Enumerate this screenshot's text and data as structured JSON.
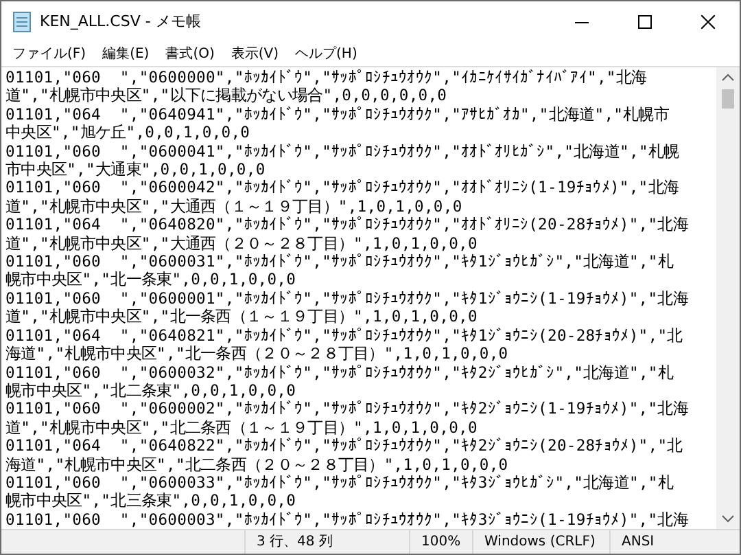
{
  "window": {
    "title": "KEN_ALL.CSV - メモ帳"
  },
  "menu": [
    "ファイル(F)",
    "編集(E)",
    "書式(O)",
    "表示(V)",
    "ヘルプ(H)"
  ],
  "lines": [
    "01101,\"060  \",\"0600000\",\"ﾎｯｶｲﾄﾞｳ\",\"ｻｯﾎﾟﾛｼﾁｭｳｵｳｸ\",\"ｲｶﾆｹｲｻｲｶﾞﾅｲﾊﾞｱｲ\",\"北海",
    "道\",\"札幌市中央区\",\"以下に掲載がない場合\",0,0,0,0,0,0",
    "01101,\"064  \",\"0640941\",\"ﾎｯｶｲﾄﾞｳ\",\"ｻｯﾎﾟﾛｼﾁｭｳｵｳｸ\",\"ｱｻﾋｶﾞｵｶ\",\"北海道\",\"札幌市",
    "中央区\",\"旭ケ丘\",0,0,1,0,0,0",
    "01101,\"060  \",\"0600041\",\"ﾎｯｶｲﾄﾞｳ\",\"ｻｯﾎﾟﾛｼﾁｭｳｵｳｸ\",\"ｵｵﾄﾞｵﾘﾋｶﾞｼ\",\"北海道\",\"札幌",
    "市中央区\",\"大通東\",0,0,1,0,0,0",
    "01101,\"060  \",\"0600042\",\"ﾎｯｶｲﾄﾞｳ\",\"ｻｯﾎﾟﾛｼﾁｭｳｵｳｸ\",\"ｵｵﾄﾞｵﾘﾆｼ(1-19ﾁｮｳﾒ)\",\"北海",
    "道\",\"札幌市中央区\",\"大通西（１～１９丁目）\",1,0,1,0,0,0",
    "01101,\"064  \",\"0640820\",\"ﾎｯｶｲﾄﾞｳ\",\"ｻｯﾎﾟﾛｼﾁｭｳｵｳｸ\",\"ｵｵﾄﾞｵﾘﾆｼ(20-28ﾁｮｳﾒ)\",\"北海",
    "道\",\"札幌市中央区\",\"大通西（２０～２８丁目）\",1,0,1,0,0,0",
    "01101,\"060  \",\"0600031\",\"ﾎｯｶｲﾄﾞｳ\",\"ｻｯﾎﾟﾛｼﾁｭｳｵｳｸ\",\"ｷﾀ1ｼﾞｮｳﾋｶﾞｼ\",\"北海道\",\"札",
    "幌市中央区\",\"北一条東\",0,0,1,0,0,0",
    "01101,\"060  \",\"0600001\",\"ﾎｯｶｲﾄﾞｳ\",\"ｻｯﾎﾟﾛｼﾁｭｳｵｳｸ\",\"ｷﾀ1ｼﾞｮｳﾆｼ(1-19ﾁｮｳﾒ)\",\"北海",
    "道\",\"札幌市中央区\",\"北一条西（１～１９丁目）\",1,0,1,0,0,0",
    "01101,\"064  \",\"0640821\",\"ﾎｯｶｲﾄﾞｳ\",\"ｻｯﾎﾟﾛｼﾁｭｳｵｳｸ\",\"ｷﾀ1ｼﾞｮｳﾆｼ(20-28ﾁｮｳﾒ)\",\"北",
    "海道\",\"札幌市中央区\",\"北一条西（２０～２８丁目）\",1,0,1,0,0,0",
    "01101,\"060  \",\"0600032\",\"ﾎｯｶｲﾄﾞｳ\",\"ｻｯﾎﾟﾛｼﾁｭｳｵｳｸ\",\"ｷﾀ2ｼﾞｮｳﾋｶﾞｼ\",\"北海道\",\"札",
    "幌市中央区\",\"北二条東\",0,0,1,0,0,0",
    "01101,\"060  \",\"0600002\",\"ﾎｯｶｲﾄﾞｳ\",\"ｻｯﾎﾟﾛｼﾁｭｳｵｳｸ\",\"ｷﾀ2ｼﾞｮｳﾆｼ(1-19ﾁｮｳﾒ)\",\"北海",
    "道\",\"札幌市中央区\",\"北二条西（１～１９丁目）\",1,0,1,0,0,0",
    "01101,\"064  \",\"0640822\",\"ﾎｯｶｲﾄﾞｳ\",\"ｻｯﾎﾟﾛｼﾁｭｳｵｳｸ\",\"ｷﾀ2ｼﾞｮｳﾆｼ(20-28ﾁｮｳﾒ)\",\"北",
    "海道\",\"札幌市中央区\",\"北二条西（２０～２８丁目）\",1,0,1,0,0,0",
    "01101,\"060  \",\"0600033\",\"ﾎｯｶｲﾄﾞｳ\",\"ｻｯﾎﾟﾛｼﾁｭｳｵｳｸ\",\"ｷﾀ3ｼﾞｮｳﾋｶﾞｼ\",\"北海道\",\"札",
    "幌市中央区\",\"北三条東\",0,0,1,0,0,0",
    "01101,\"060  \",\"0600003\",\"ﾎｯｶｲﾄﾞｳ\",\"ｻｯﾎﾟﾛｼﾁｭｳｵｳｸ\",\"ｷﾀ3ｼﾞｮｳﾆｼ(1-19ﾁｮｳﾒ)\",\"北海"
  ],
  "status_bar": {
    "position": "3 行、48 列",
    "zoom": "100%",
    "line_ending": "Windows (CRLF)",
    "encoding": "ANSI"
  }
}
